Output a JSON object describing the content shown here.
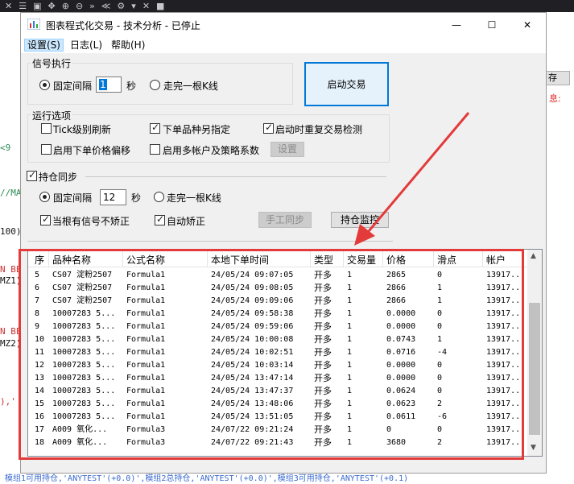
{
  "background": {
    "toolbar_glyphs": [
      "✕",
      "☰",
      "▣",
      "✥",
      "⊕",
      "⊖",
      "»",
      "≪",
      "⚙",
      "▾",
      "✕",
      "■"
    ],
    "code_lines": [
      {
        "text": "<9",
        "color": "green"
      },
      {
        "text": "//MA",
        "color": "green"
      },
      {
        "text": "100)",
        "color": "black"
      },
      {
        "text": "N BE",
        "color": "red"
      },
      {
        "text": "MZ1)",
        "color": "black"
      },
      {
        "text": "N BE",
        "color": "red"
      },
      {
        "text": "MZ2)",
        "color": "black"
      },
      {
        "text": "),'",
        "color": "red"
      }
    ],
    "save_button": "存",
    "red_text": "息:",
    "bottom_line": "模组1可用持仓,'ANYTEST'(+0.0)',模组2总持仓,'ANYTEST'(+0.0)',模组3可用持仓,'ANYTEST'(+0.1)"
  },
  "window": {
    "title": "图表程式化交易 - 技术分析 - 已停止",
    "minimize": "—",
    "maximize": "☐",
    "close": "✕"
  },
  "menu": {
    "settings": "设置(S)",
    "log": "日志(L)",
    "help": "帮助(H)"
  },
  "signal": {
    "group_label": "信号执行",
    "fixed_interval_label": "固定间隔",
    "interval_value": "1",
    "seconds": "秒",
    "kbar_label": "走完一根K线",
    "start_button": "启动交易"
  },
  "run_options": {
    "group_label": "运行选项",
    "tick_refresh": "Tick级别刷新",
    "order_other_contract": "下单品种另指定",
    "recheck_on_start": "启动时重复交易检测",
    "price_offset": "启用下单价格偏移",
    "multi_account": "启用多帐户及策略系数",
    "settings_button": "设置"
  },
  "position_sync": {
    "label": "持仓同步",
    "fixed_interval_label": "固定间隔",
    "interval_value": "12",
    "seconds": "秒",
    "kbar_label": "走完一根K线",
    "no_correct_on_signal": "当根有信号不矫正",
    "auto_correct": "自动矫正",
    "manual_sync_button": "手工同步",
    "monitor_button": "持仓监控"
  },
  "table": {
    "columns": [
      "序",
      "品种名称",
      "公式名称",
      "本地下单时间",
      "类型",
      "交易量",
      "价格",
      "滑点",
      "帐户"
    ],
    "rows": [
      [
        "5",
        "CS07 淀粉2507",
        "Formula1",
        "24/05/24 09:07:05",
        "开多",
        "1",
        "2865",
        "0",
        "13917..."
      ],
      [
        "6",
        "CS07 淀粉2507",
        "Formula1",
        "24/05/24 09:08:05",
        "开多",
        "1",
        "2866",
        "1",
        "13917..."
      ],
      [
        "7",
        "CS07 淀粉2507",
        "Formula1",
        "24/05/24 09:09:06",
        "开多",
        "1",
        "2866",
        "1",
        "13917..."
      ],
      [
        "8",
        "10007283 5...",
        "Formula1",
        "24/05/24 09:58:38",
        "开多",
        "1",
        "0.0000",
        "0",
        "13917..."
      ],
      [
        "9",
        "10007283 5...",
        "Formula1",
        "24/05/24 09:59:06",
        "开多",
        "1",
        "0.0000",
        "0",
        "13917..."
      ],
      [
        "10",
        "10007283 5...",
        "Formula1",
        "24/05/24 10:00:08",
        "开多",
        "1",
        "0.0743",
        "1",
        "13917..."
      ],
      [
        "11",
        "10007283 5...",
        "Formula1",
        "24/05/24 10:02:51",
        "开多",
        "1",
        "0.0716",
        "-4",
        "13917..."
      ],
      [
        "12",
        "10007283 5...",
        "Formula1",
        "24/05/24 10:03:14",
        "开多",
        "1",
        "0.0000",
        "0",
        "13917..."
      ],
      [
        "13",
        "10007283 5...",
        "Formula1",
        "24/05/24 13:47:14",
        "开多",
        "1",
        "0.0000",
        "0",
        "13917..."
      ],
      [
        "14",
        "10007283 5...",
        "Formula1",
        "24/05/24 13:47:37",
        "开多",
        "1",
        "0.0624",
        "0",
        "13917..."
      ],
      [
        "15",
        "10007283 5...",
        "Formula1",
        "24/05/24 13:48:06",
        "开多",
        "1",
        "0.0623",
        "2",
        "13917..."
      ],
      [
        "16",
        "10007283 5...",
        "Formula1",
        "24/05/24 13:51:05",
        "开多",
        "1",
        "0.0611",
        "-6",
        "13917..."
      ],
      [
        "17",
        "A009 氧化...",
        "Formula3",
        "24/07/22 09:21:24",
        "开多",
        "1",
        "0",
        "0",
        "13917..."
      ],
      [
        "18",
        "A009 氧化...",
        "Formula3",
        "24/07/22 09:21:43",
        "开多",
        "1",
        "3680",
        "2",
        "13917..."
      ]
    ]
  }
}
